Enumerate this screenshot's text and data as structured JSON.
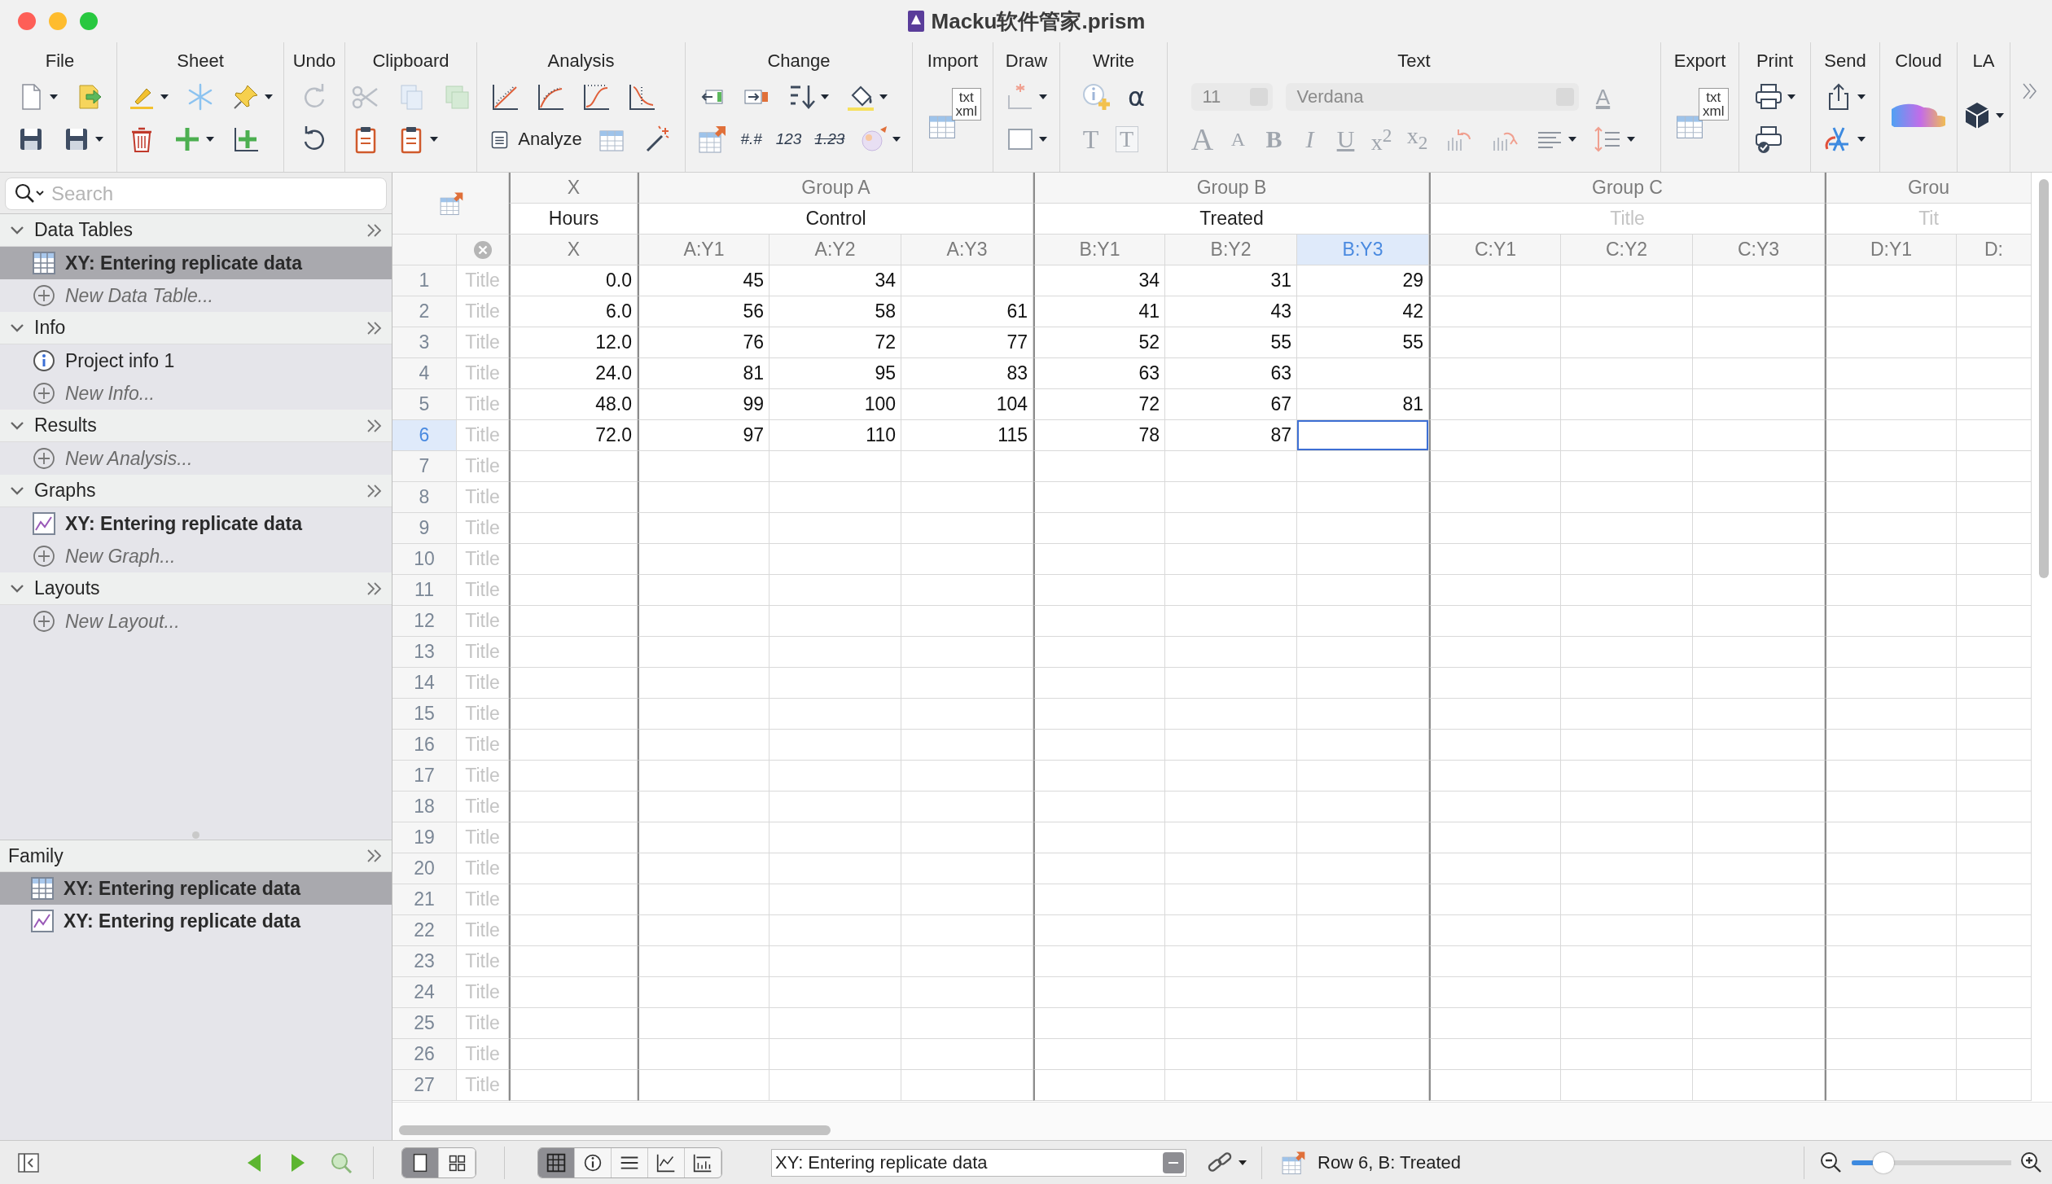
{
  "window": {
    "title": "Macku软件管家.prism"
  },
  "toolbar": [
    {
      "label": "File"
    },
    {
      "label": "Sheet"
    },
    {
      "label": "Undo"
    },
    {
      "label": "Clipboard"
    },
    {
      "label": "Analysis",
      "button": "Analyze"
    },
    {
      "label": "Change",
      "glyphs": [
        {
          "text": "#.#",
          "kind": "format"
        },
        {
          "text": "123",
          "kind": "number"
        },
        {
          "text": "1.23",
          "kind": "decimal"
        }
      ]
    },
    {
      "label": "Import",
      "icon_text": [
        "txt",
        "xml"
      ]
    },
    {
      "label": "Draw"
    },
    {
      "label": "Write",
      "glyphs": [
        {
          "text": "α",
          "kind": "symbol"
        },
        {
          "text": "T",
          "kind": "serif"
        },
        {
          "text": "T",
          "kind": "boxed"
        }
      ]
    },
    {
      "label": "Text",
      "font_size": "11",
      "font": "Verdana",
      "glyphs": [
        {
          "text": "A",
          "kind": "color"
        },
        {
          "text": "A",
          "kind": "large"
        },
        {
          "text": "A",
          "kind": "small"
        },
        {
          "text": "B",
          "kind": "bold"
        },
        {
          "text": "I",
          "kind": "italic"
        },
        {
          "text": "U",
          "kind": "underline"
        },
        {
          "text": "x$^{2}$",
          "kind": "superscript"
        },
        {
          "text": "x$_{2}$",
          "kind": "subscript"
        }
      ]
    },
    {
      "label": "Export",
      "icon_text": [
        "txt",
        "xml"
      ]
    },
    {
      "label": "Print"
    },
    {
      "label": "Send"
    },
    {
      "label": "Cloud"
    },
    {
      "label": "LA"
    }
  ],
  "sidebar": {
    "search_placeholder": "Search",
    "sections": [
      {
        "name": "Data Tables",
        "expanded": true,
        "items": [
          {
            "kind": "table",
            "label": "XY: Entering replicate data",
            "selected": true
          },
          {
            "kind": "new",
            "label": "New Data Table...",
            "selected": false
          }
        ]
      },
      {
        "name": "Info",
        "expanded": true,
        "items": [
          {
            "kind": "info",
            "label": "Project info 1",
            "selected": false
          },
          {
            "kind": "new",
            "label": "New Info...",
            "selected": false
          }
        ]
      },
      {
        "name": "Results",
        "expanded": true,
        "items": [
          {
            "kind": "new",
            "label": "New Analysis...",
            "selected": false
          }
        ]
      },
      {
        "name": "Graphs",
        "expanded": true,
        "items": [
          {
            "kind": "graph",
            "label": "XY: Entering replicate data",
            "selected": false
          },
          {
            "kind": "new",
            "label": "New Graph...",
            "selected": false
          }
        ]
      },
      {
        "name": "Layouts",
        "expanded": true,
        "items": [
          {
            "kind": "new",
            "label": "New Layout...",
            "selected": false
          }
        ]
      }
    ],
    "family": {
      "title": "Family",
      "items": [
        {
          "kind": "table",
          "label": "XY: Entering replicate data",
          "selected": true
        },
        {
          "kind": "graph",
          "label": "XY: Entering replicate data",
          "selected": false
        }
      ]
    }
  },
  "sheet": {
    "groups": [
      {
        "name": "X",
        "title": "Hours",
        "columns": [
          {
            "name": "X",
            "selected": false
          }
        ]
      },
      {
        "name": "Group A",
        "title": "Control",
        "columns": [
          {
            "name": "A:Y1",
            "selected": false
          },
          {
            "name": "A:Y2",
            "selected": false
          },
          {
            "name": "A:Y3",
            "selected": false
          }
        ]
      },
      {
        "name": "Group B",
        "title": "Treated",
        "columns": [
          {
            "name": "B:Y1",
            "selected": false
          },
          {
            "name": "B:Y2",
            "selected": false
          },
          {
            "name": "B:Y3",
            "selected": true
          }
        ]
      },
      {
        "name": "Group C",
        "title_placeholder": "Title",
        "columns": [
          {
            "name": "C:Y1",
            "selected": false
          },
          {
            "name": "C:Y2",
            "selected": false
          },
          {
            "name": "C:Y3",
            "selected": false
          }
        ]
      },
      {
        "name": "Grou",
        "title_placeholder": "Tit",
        "columns": [
          {
            "name": "D:Y1",
            "selected": false
          },
          {
            "name": "D:",
            "selected": false
          }
        ]
      }
    ],
    "rows": [
      {
        "number": "1",
        "title_placeholder": "Title",
        "selected": false,
        "groups": [
          [
            "0.0"
          ],
          [
            "45",
            "34"
          ],
          [
            "34",
            "31",
            "29"
          ]
        ]
      },
      {
        "number": "2",
        "title_placeholder": "Title",
        "selected": false,
        "groups": [
          [
            "6.0"
          ],
          [
            "56",
            "58",
            "61"
          ],
          [
            "41",
            "43",
            "42"
          ]
        ]
      },
      {
        "number": "3",
        "title_placeholder": "Title",
        "selected": false,
        "groups": [
          [
            "12.0"
          ],
          [
            "76",
            "72",
            "77"
          ],
          [
            "52",
            "55",
            "55"
          ]
        ]
      },
      {
        "number": "4",
        "title_placeholder": "Title",
        "selected": false,
        "groups": [
          [
            "24.0"
          ],
          [
            "81",
            "95",
            "83"
          ],
          [
            "63",
            "63"
          ]
        ]
      },
      {
        "number": "5",
        "title_placeholder": "Title",
        "selected": false,
        "groups": [
          [
            "48.0"
          ],
          [
            "99",
            "100",
            "104"
          ],
          [
            "72",
            "67",
            "81"
          ]
        ]
      },
      {
        "number": "6",
        "title_placeholder": "Title",
        "selected": true,
        "groups": [
          [
            "72.0"
          ],
          [
            "97",
            "110",
            "115"
          ],
          [
            "78",
            "87"
          ]
        ]
      },
      {
        "number": "7",
        "title_placeholder": "Title",
        "selected": false
      },
      {
        "number": "8",
        "title_placeholder": "Title",
        "selected": false
      },
      {
        "number": "9",
        "title_placeholder": "Title",
        "selected": false
      },
      {
        "number": "10",
        "title_placeholder": "Title",
        "selected": false
      },
      {
        "number": "11",
        "title_placeholder": "Title",
        "selected": false
      },
      {
        "number": "12",
        "title_placeholder": "Title",
        "selected": false
      },
      {
        "number": "13",
        "title_placeholder": "Title",
        "selected": false
      },
      {
        "number": "14",
        "title_placeholder": "Title",
        "selected": false
      },
      {
        "number": "15",
        "title_placeholder": "Title",
        "selected": false
      },
      {
        "number": "16",
        "title_placeholder": "Title",
        "selected": false
      },
      {
        "number": "17",
        "title_placeholder": "Title",
        "selected": false
      },
      {
        "number": "18",
        "title_placeholder": "Title",
        "selected": false
      },
      {
        "number": "19",
        "title_placeholder": "Title",
        "selected": false
      },
      {
        "number": "20",
        "title_placeholder": "Title",
        "selected": false
      },
      {
        "number": "21",
        "title_placeholder": "Title",
        "selected": false
      },
      {
        "number": "22",
        "title_placeholder": "Title",
        "selected": false
      },
      {
        "number": "23",
        "title_placeholder": "Title",
        "selected": false
      },
      {
        "number": "24",
        "title_placeholder": "Title",
        "selected": false
      },
      {
        "number": "25",
        "title_placeholder": "Title",
        "selected": false
      },
      {
        "number": "26",
        "title_placeholder": "Title",
        "selected": false
      },
      {
        "number": "27",
        "title_placeholder": "Title",
        "selected": false
      }
    ]
  },
  "status_bar": {
    "view_modes": [
      {
        "selected": true
      },
      {
        "selected": false
      }
    ],
    "sheet_views": [
      {
        "selected": true
      },
      {
        "selected": false
      },
      {
        "selected": false
      },
      {
        "selected": false
      },
      {
        "selected": false
      }
    ],
    "sheet_name": "XY: Entering replicate data",
    "status": "Row 6, B: Treated",
    "zoom": {
      "level": 0.15
    }
  }
}
